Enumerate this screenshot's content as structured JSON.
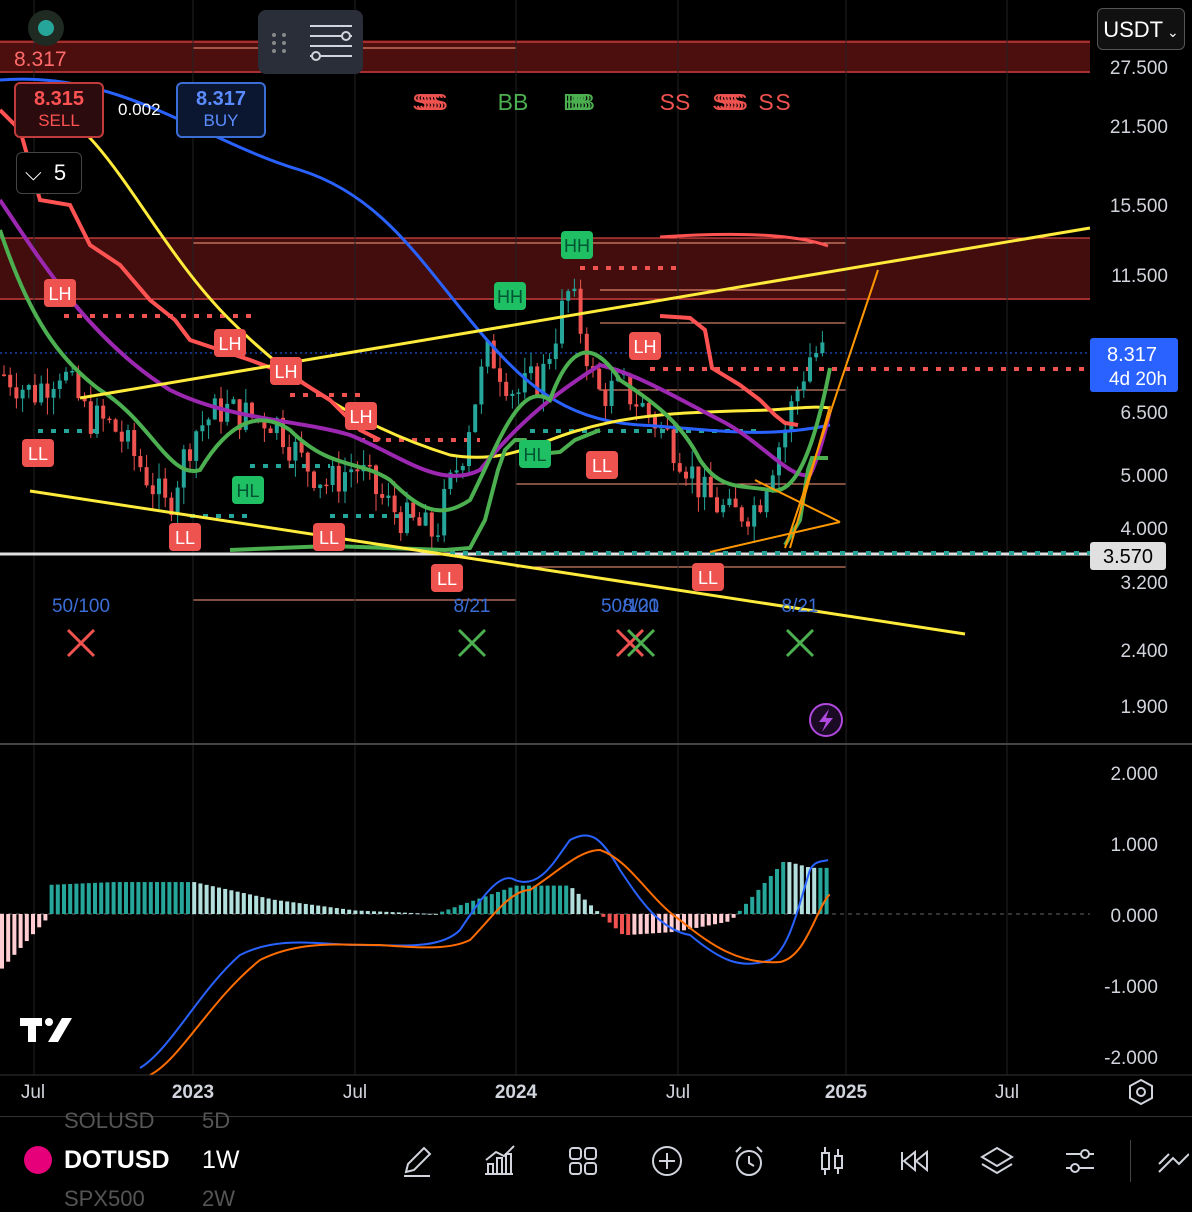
{
  "quote_currency": "USDT",
  "ticket": {
    "sell_price": "8.315",
    "sell_label": "SELL",
    "buy_price": "8.317",
    "buy_label": "BUY",
    "spread": "0.002"
  },
  "last_price_top": "8.317",
  "collapse_count": "5",
  "price_axis": {
    "scale": "log",
    "ticks": [
      "27.500",
      "21.500",
      "15.500",
      "11.500",
      "6.500",
      "5.000",
      "4.000",
      "3.200",
      "2.400",
      "1.900"
    ],
    "current_price": "8.317",
    "countdown": "4d 20h",
    "support_label": "3.570"
  },
  "macd_axis": {
    "ticks": [
      "2.000",
      "1.000",
      "0.000",
      "-1.000",
      "-2.000"
    ]
  },
  "time_axis": {
    "ticks": [
      "Jul",
      "2023",
      "Jul",
      "2024",
      "Jul",
      "2025",
      "Jul"
    ]
  },
  "markers": {
    "structure": [
      "LH",
      "LL",
      "LH",
      "LH",
      "HL",
      "LH",
      "LL",
      "LL",
      "LL",
      "HH",
      "HH",
      "HL",
      "LH",
      "LL",
      "LL"
    ],
    "signals": [
      "SSSSSSS",
      "BB",
      "BBBBBB",
      "SS",
      "SSSSSSS",
      "S",
      "S"
    ],
    "cross_labels": [
      "50/100",
      "8/21",
      "50/100",
      "8/21",
      "8/21"
    ]
  },
  "colors": {
    "up": "#26a69a",
    "down": "#ef5350",
    "ema_fast": "#4caf50",
    "ema_purple": "#9c27b0",
    "ema_yellow": "#ffeb3b",
    "ema_blue": "#2962ff",
    "trail_red": "#ff5252",
    "trendline": "#ffeb3b",
    "wedge": "#ff9800",
    "macd_line": "#2962ff",
    "signal_line": "#ff6d00"
  },
  "chart_data": {
    "type": "candlestick",
    "timeframe": "1W",
    "price_scale": "log",
    "ylim": [
      1.8,
      30
    ],
    "x_range": [
      "2022-06",
      "2025-10"
    ],
    "close_approx": [
      {
        "date": "2022-06",
        "price": 7.6
      },
      {
        "date": "2022-07",
        "price": 7.0
      },
      {
        "date": "2022-08",
        "price": 7.8
      },
      {
        "date": "2022-09",
        "price": 6.4
      },
      {
        "date": "2022-10",
        "price": 6.1
      },
      {
        "date": "2022-11",
        "price": 5.2
      },
      {
        "date": "2022-12",
        "price": 4.3
      },
      {
        "date": "2023-01",
        "price": 6.0
      },
      {
        "date": "2023-02",
        "price": 6.6
      },
      {
        "date": "2023-03",
        "price": 6.4
      },
      {
        "date": "2023-04",
        "price": 6.3
      },
      {
        "date": "2023-05",
        "price": 5.3
      },
      {
        "date": "2023-06",
        "price": 4.8
      },
      {
        "date": "2023-07",
        "price": 5.2
      },
      {
        "date": "2023-08",
        "price": 4.5
      },
      {
        "date": "2023-09",
        "price": 4.1
      },
      {
        "date": "2023-10",
        "price": 3.9
      },
      {
        "date": "2023-11",
        "price": 5.5
      },
      {
        "date": "2023-12",
        "price": 8.4
      },
      {
        "date": "2024-01",
        "price": 7.0
      },
      {
        "date": "2024-02",
        "price": 7.6
      },
      {
        "date": "2024-03",
        "price": 10.8
      },
      {
        "date": "2024-04",
        "price": 7.0
      },
      {
        "date": "2024-05",
        "price": 7.2
      },
      {
        "date": "2024-06",
        "price": 6.4
      },
      {
        "date": "2024-07",
        "price": 5.6
      },
      {
        "date": "2024-08",
        "price": 4.6
      },
      {
        "date": "2024-09",
        "price": 4.2
      },
      {
        "date": "2024-10",
        "price": 4.4
      },
      {
        "date": "2024-11",
        "price": 6.0
      },
      {
        "date": "2024-12",
        "price": 8.317
      }
    ],
    "macd_approx": [
      {
        "date": "2022-07",
        "hist": 0.4,
        "macd": -2.0
      },
      {
        "date": "2022-10",
        "hist": 0.45,
        "macd": -1.3
      },
      {
        "date": "2023-01",
        "hist": 0.45,
        "macd": -0.5
      },
      {
        "date": "2023-04",
        "hist": 0.2,
        "macd": -0.45
      },
      {
        "date": "2023-07",
        "hist": 0.05,
        "macd": -0.4
      },
      {
        "date": "2023-10",
        "hist": 0.0,
        "macd": -0.4
      },
      {
        "date": "2024-01",
        "hist": 0.4,
        "macd": 0.4
      },
      {
        "date": "2024-03",
        "hist": 0.4,
        "macd": 1.1
      },
      {
        "date": "2024-05",
        "hist": -0.3,
        "macd": 0.6
      },
      {
        "date": "2024-07",
        "hist": -0.25,
        "macd": -0.2
      },
      {
        "date": "2024-09",
        "hist": -0.1,
        "macd": -0.75
      },
      {
        "date": "2024-11",
        "hist": 0.75,
        "macd": -0.2
      },
      {
        "date": "2024-12",
        "hist": 0.65,
        "macd": 0.75
      }
    ]
  },
  "bottom_bar": {
    "symbol": "DOTUSD",
    "timeframe": "1W",
    "ghost_symbol_above": "SOLUSD",
    "ghost_tf_above": "5D",
    "ghost_symbol_below": "SPX500",
    "ghost_tf_below": "2W"
  }
}
